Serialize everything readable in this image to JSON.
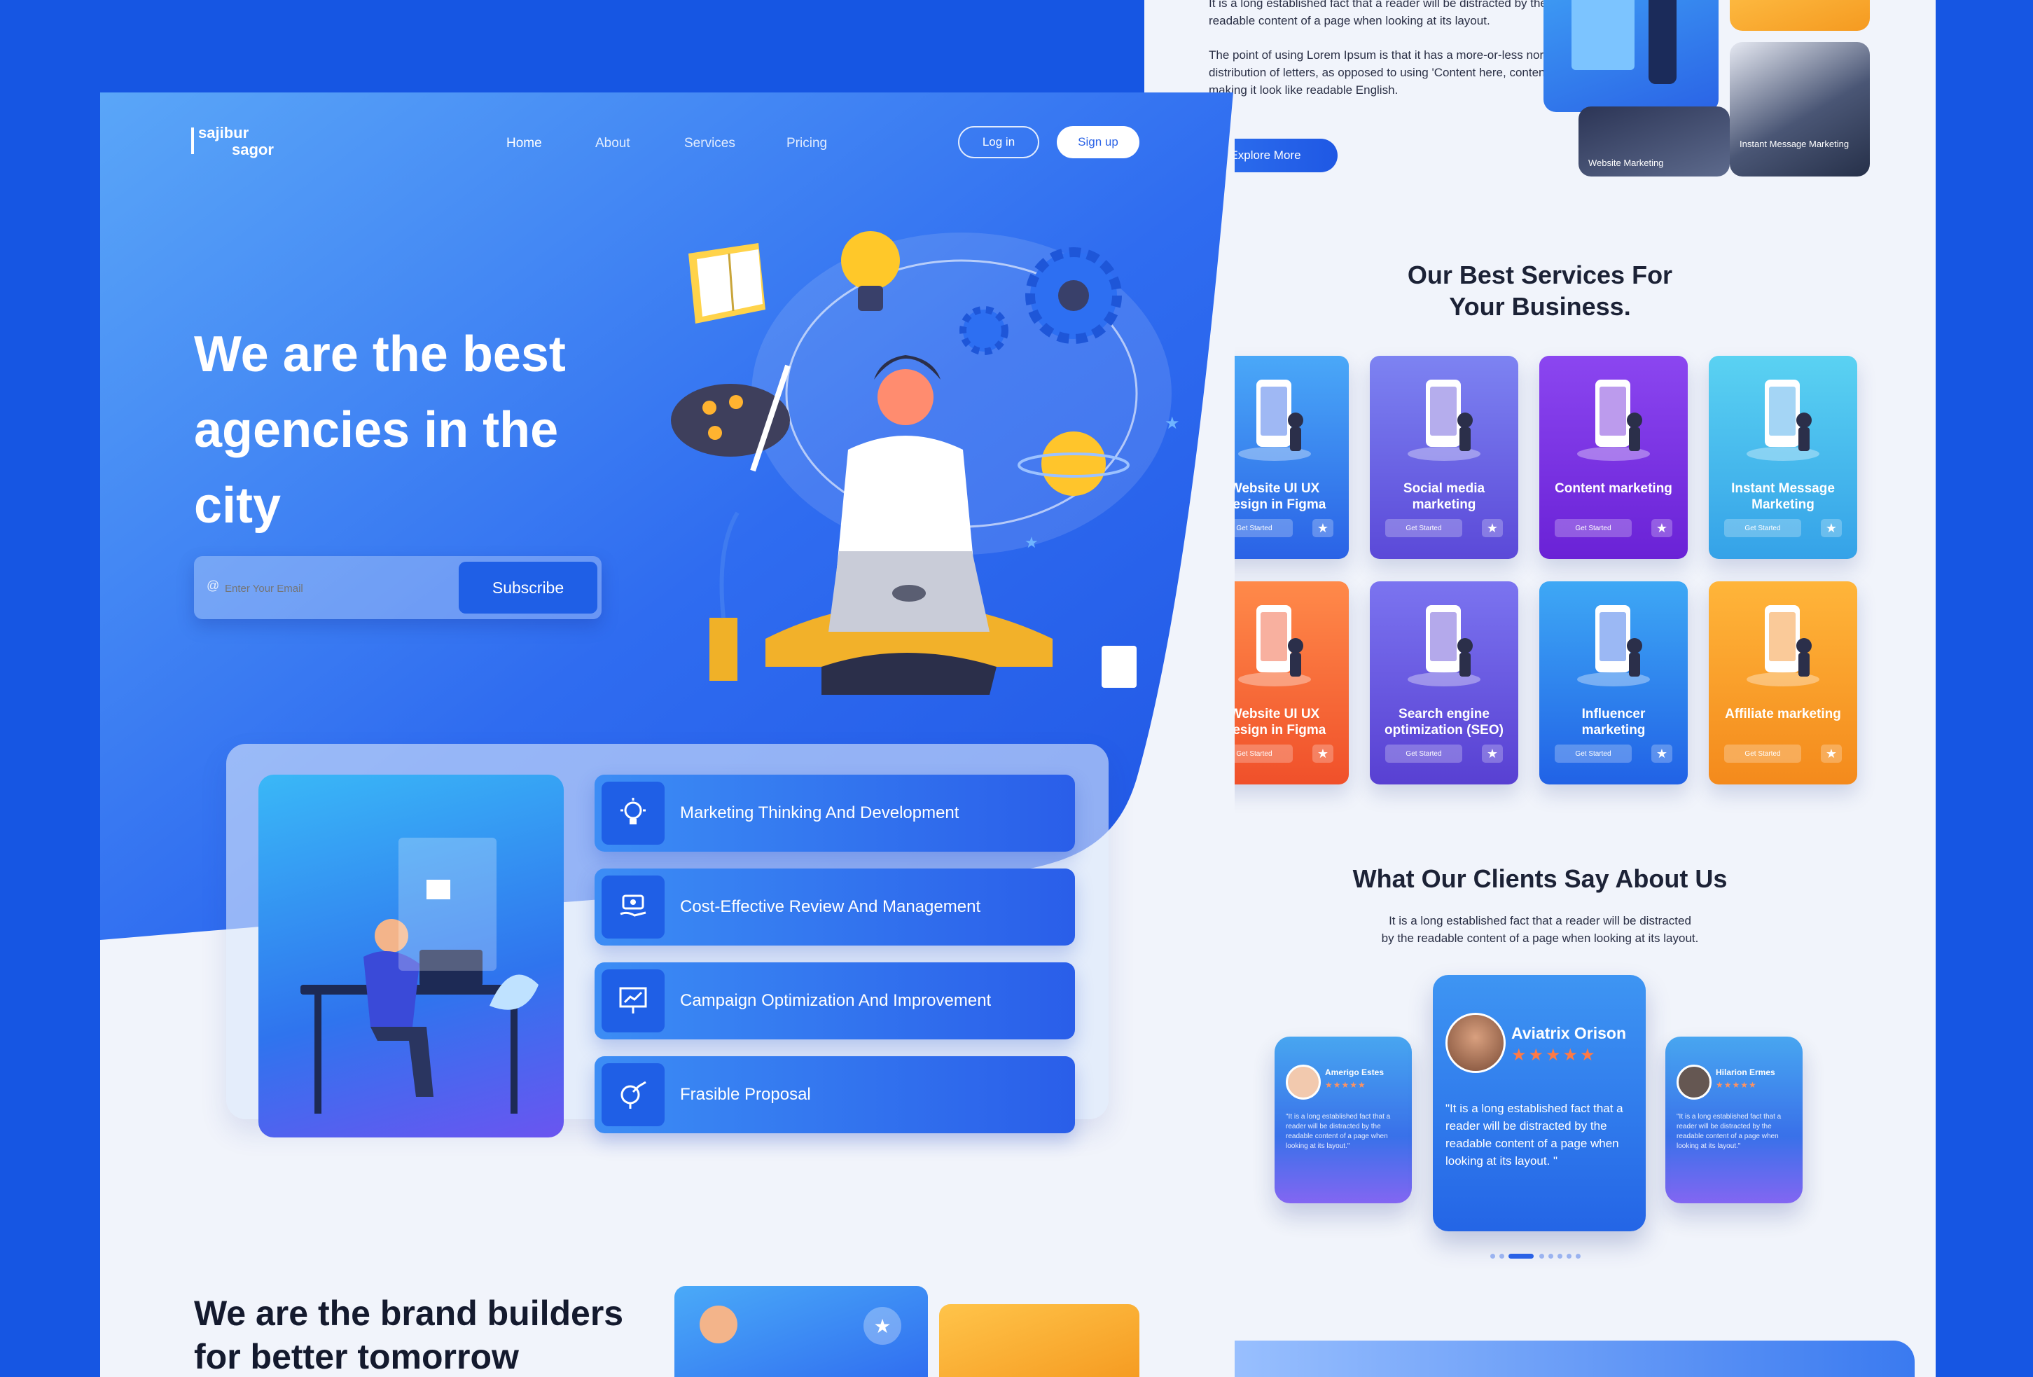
{
  "right_page": {
    "intro_paragraph_1": "It is a long established fact that a reader will be distracted by the readable content of a page when looking at its layout.",
    "intro_paragraph_2": "The point of using Lorem Ipsum is that it has a more-or-less normal distribution of letters, as opposed to using 'Content here, content here', making it look like readable English.",
    "explore_button": "Explore More",
    "thumb_label_1": "Website Marketing",
    "thumb_label_2": "Instant Message Marketing",
    "services_heading_line1": "Our Best Services For",
    "services_heading_line2": "Your Business.",
    "service_cta": "Get Started",
    "services": [
      {
        "title": "Website UI UX Design in Figma",
        "color_top": "#4aa8f8",
        "color_bottom": "#2a62e6"
      },
      {
        "title": "Social media marketing",
        "color_top": "#7d83f2",
        "color_bottom": "#5b49d8"
      },
      {
        "title": "Content marketing",
        "color_top": "#8b46f0",
        "color_bottom": "#6a22d6"
      },
      {
        "title": "Instant Message Marketing",
        "color_top": "#5ad2f2",
        "color_bottom": "#35a2e8"
      },
      {
        "title": "Website UI UX Design in Figma",
        "color_top": "#ff8a4a",
        "color_bottom": "#f0502a"
      },
      {
        "title": "Search engine optimization (SEO)",
        "color_top": "#7b74f0",
        "color_bottom": "#5840d2"
      },
      {
        "title": "Influencer marketing",
        "color_top": "#3ea8f5",
        "color_bottom": "#2162e6"
      },
      {
        "title": "Affiliate marketing",
        "color_top": "#ffb53a",
        "color_bottom": "#f48a1c"
      }
    ],
    "clients_heading": "What Our Clients Say About Us",
    "clients_sub_line1": "It is a long established fact that a reader will be distracted",
    "clients_sub_line2": "by the readable content of a page when looking at its layout.",
    "testimonials": [
      {
        "name": "Amerigo Estes",
        "rating": 5,
        "quote": "\"It is a long established fact that a reader will be distracted by the readable content of a page when looking at its layout.\""
      },
      {
        "name": "Aviatrix Orison",
        "rating": 5,
        "quote": "\"It is a long established fact that a reader will be distracted by the readable content of a page when looking at its layout. \""
      },
      {
        "name": "Hilarion Ermes",
        "rating": 5,
        "quote": "\"It is a long established fact that a reader will be distracted by the readable content of a page when looking at its layout.\""
      }
    ]
  },
  "left_page": {
    "logo_line1": "sajibur",
    "logo_line2": "sagor",
    "nav": [
      "Home",
      "About",
      "Services",
      "Pricing"
    ],
    "login": "Log in",
    "signup": "Sign up",
    "hero_line1": "We are the best",
    "hero_line2": "agencies in the",
    "hero_line3": "city",
    "email_placeholder": "Enter Your Email",
    "subscribe": "Subscribe",
    "features": [
      "Marketing Thinking And Development",
      "Cost-Effective Review And Management",
      "Campaign Optimization And Improvement",
      "Frasible Proposal"
    ],
    "brand_line1": "We are the brand builders",
    "brand_line2": "for better tomorrow"
  },
  "colors": {
    "brand_blue": "#1656e3",
    "accent_blue": "#2a62e6",
    "orange": "#f5a623",
    "star": "#ff7a45"
  }
}
